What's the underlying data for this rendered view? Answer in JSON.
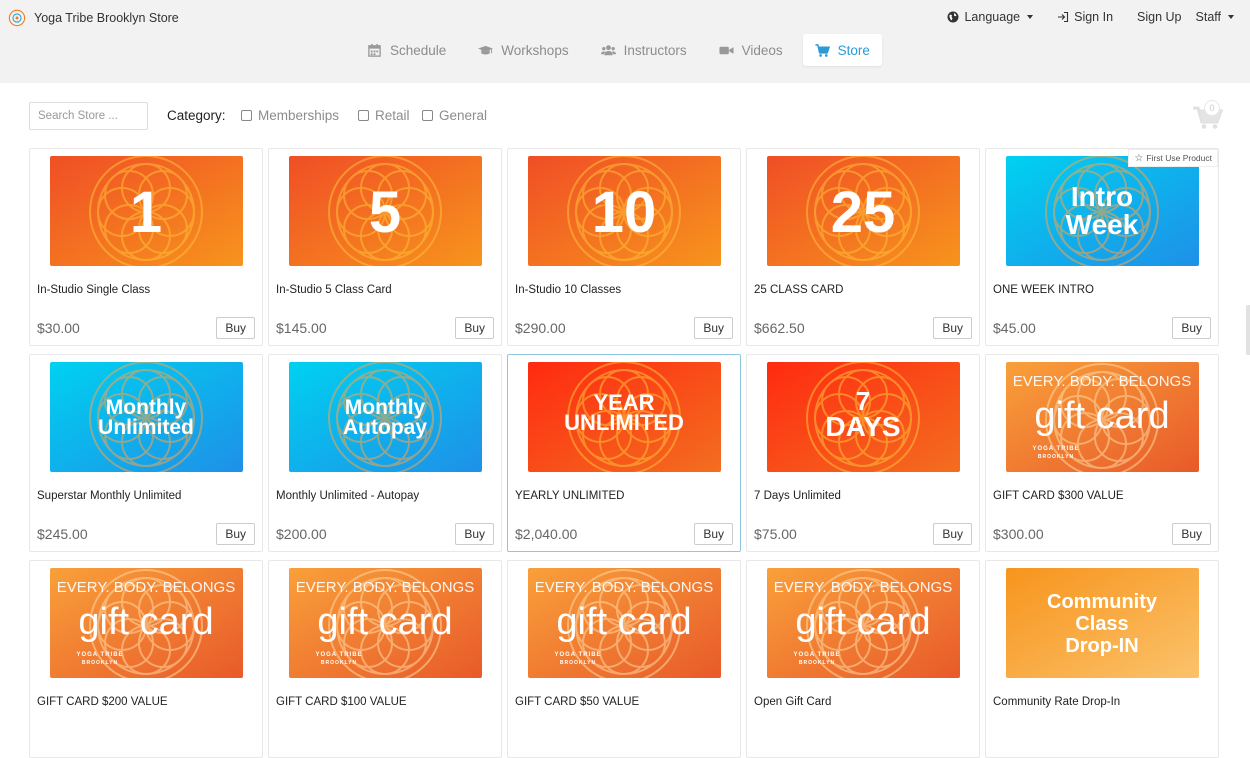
{
  "header": {
    "store_name": "Yoga Tribe Brooklyn Store",
    "language": "Language",
    "sign_in": "Sign In",
    "sign_up": "Sign Up",
    "staff": "Staff"
  },
  "nav": [
    {
      "label": "Schedule",
      "icon": "calendar-icon"
    },
    {
      "label": "Workshops",
      "icon": "graduation-cap-icon"
    },
    {
      "label": "Instructors",
      "icon": "users-icon"
    },
    {
      "label": "Videos",
      "icon": "video-camera-icon"
    },
    {
      "label": "Store",
      "icon": "shopping-cart-icon",
      "active": true
    }
  ],
  "filters": {
    "search_placeholder": "Search Store ...",
    "category_label": "Category:",
    "categories": [
      "Memberships",
      "Retail",
      "General"
    ]
  },
  "cart": {
    "count": "0"
  },
  "colors": {
    "accent": "#2b9bd6",
    "orange_gradient": [
      "#f04e25",
      "#f7941d"
    ],
    "blue_gradient": [
      "#00d1f0",
      "#1e90e8"
    ],
    "red_gradient": [
      "#ff2a10",
      "#f36e20"
    ],
    "gift_gradient": [
      "#f9a03a",
      "#e85a2a"
    ]
  },
  "products": [
    {
      "name": "In-Studio Single Class",
      "price": "$30.00",
      "buy": "Buy",
      "art": {
        "style": "orange",
        "lines": [
          "1"
        ]
      }
    },
    {
      "name": "In-Studio 5 Class Card",
      "price": "$145.00",
      "buy": "Buy",
      "art": {
        "style": "orange",
        "lines": [
          "5"
        ]
      }
    },
    {
      "name": "In-Studio 10 Classes",
      "price": "$290.00",
      "buy": "Buy",
      "art": {
        "style": "orange",
        "lines": [
          "10"
        ]
      }
    },
    {
      "name": "25 CLASS CARD",
      "price": "$662.50",
      "buy": "Buy",
      "art": {
        "style": "orange",
        "lines": [
          "25"
        ]
      }
    },
    {
      "name": "ONE WEEK INTRO",
      "price": "$45.00",
      "buy": "Buy",
      "badge": "First Use Product",
      "art": {
        "style": "blue",
        "lines": [
          "Intro",
          "Week"
        ]
      }
    },
    {
      "name": "Superstar Monthly Unlimited",
      "price": "$245.00",
      "buy": "Buy",
      "art": {
        "style": "blue",
        "lines": [
          "Monthly",
          "Unlimited"
        ]
      }
    },
    {
      "name": "Monthly Unlimited - Autopay",
      "price": "$200.00",
      "buy": "Buy",
      "art": {
        "style": "blue",
        "lines": [
          "Monthly",
          "Autopay"
        ]
      }
    },
    {
      "name": "YEARLY UNLIMITED",
      "price": "$2,040.00",
      "buy": "Buy",
      "highlighted": true,
      "art": {
        "style": "red",
        "lines": [
          "YEAR",
          "UNLIMITED"
        ]
      }
    },
    {
      "name": "7 Days Unlimited",
      "price": "$75.00",
      "buy": "Buy",
      "art": {
        "style": "red",
        "lines": [
          "7",
          "DAYS"
        ]
      }
    },
    {
      "name": "GIFT CARD $300 VALUE",
      "price": "$300.00",
      "buy": "Buy",
      "art": {
        "style": "gift",
        "lines": [
          "EVERY. BODY. BELONGS",
          "gift card",
          "YOGA TRIBE",
          "BROOKLYN"
        ]
      }
    },
    {
      "name": "GIFT CARD $200 VALUE",
      "art": {
        "style": "gift",
        "lines": [
          "EVERY. BODY. BELONGS",
          "gift card",
          "YOGA TRIBE",
          "BROOKLYN"
        ]
      }
    },
    {
      "name": "GIFT CARD $100 VALUE",
      "art": {
        "style": "gift",
        "lines": [
          "EVERY. BODY. BELONGS",
          "gift card",
          "YOGA TRIBE",
          "BROOKLYN"
        ]
      }
    },
    {
      "name": "GIFT CARD $50 VALUE",
      "art": {
        "style": "gift",
        "lines": [
          "EVERY. BODY. BELONGS",
          "gift card",
          "YOGA TRIBE",
          "BROOKLYN"
        ]
      }
    },
    {
      "name": "Open Gift Card",
      "art": {
        "style": "gift",
        "lines": [
          "EVERY. BODY. BELONGS",
          "gift card",
          "YOGA TRIBE",
          "BROOKLYN"
        ]
      }
    },
    {
      "name": "Community Rate Drop-In",
      "art": {
        "style": "community",
        "lines": [
          "Community",
          "Class",
          "Drop-IN"
        ]
      }
    }
  ]
}
